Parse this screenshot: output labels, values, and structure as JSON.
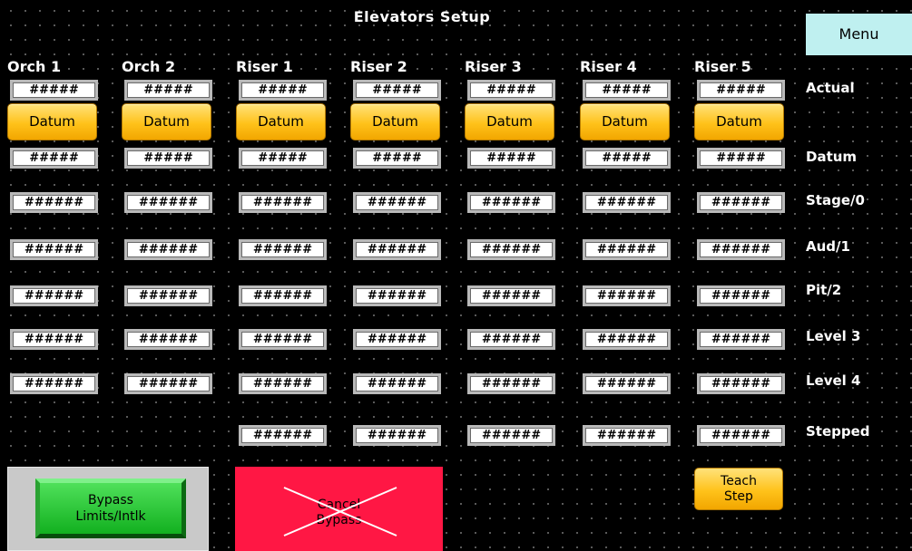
{
  "title": "Elevators Setup",
  "menu_label": "Menu",
  "columns": [
    "Orch 1",
    "Orch 2",
    "Riser 1",
    "Riser 2",
    "Riser 3",
    "Riser 4",
    "Riser 5"
  ],
  "row_labels": {
    "actual": "Actual",
    "datum": "Datum",
    "stage": "Stage/0",
    "aud": "Aud/1",
    "pit": "Pit/2",
    "level3": "Level 3",
    "level4": "Level 4",
    "stepped": "Stepped"
  },
  "actual_values": [
    "#####",
    "#####",
    "#####",
    "#####",
    "#####",
    "#####",
    "#####"
  ],
  "datum_button_label": "Datum",
  "datum_values": [
    "#####",
    "#####",
    "#####",
    "#####",
    "#####",
    "#####",
    "#####"
  ],
  "stage_values": [
    "######",
    "######",
    "######",
    "######",
    "######",
    "######",
    "######"
  ],
  "aud_values": [
    "######",
    "######",
    "######",
    "######",
    "######",
    "######",
    "######"
  ],
  "pit_values": [
    "######",
    "######",
    "######",
    "######",
    "######",
    "######",
    "######"
  ],
  "level3_values": [
    "######",
    "######",
    "######",
    "######",
    "######",
    "######",
    "######"
  ],
  "level4_values": [
    "######",
    "######",
    "######",
    "######",
    "######",
    "######",
    "######"
  ],
  "stepped_values": [
    "######",
    "######",
    "######",
    "######",
    "######"
  ],
  "bypass_label": {
    "line1": "Bypass",
    "line2": "Limits/Intlk"
  },
  "cancel_bypass_label": {
    "line1": "Cancel",
    "line2": "Bypass"
  },
  "teach_step_label": {
    "line1": "Teach",
    "line2": "Step"
  },
  "colors": {
    "datum_button": "#ffc21a",
    "bypass_button": "#12b01f",
    "cancel_button": "#ff1744",
    "menu_button": "#bff0f0"
  }
}
